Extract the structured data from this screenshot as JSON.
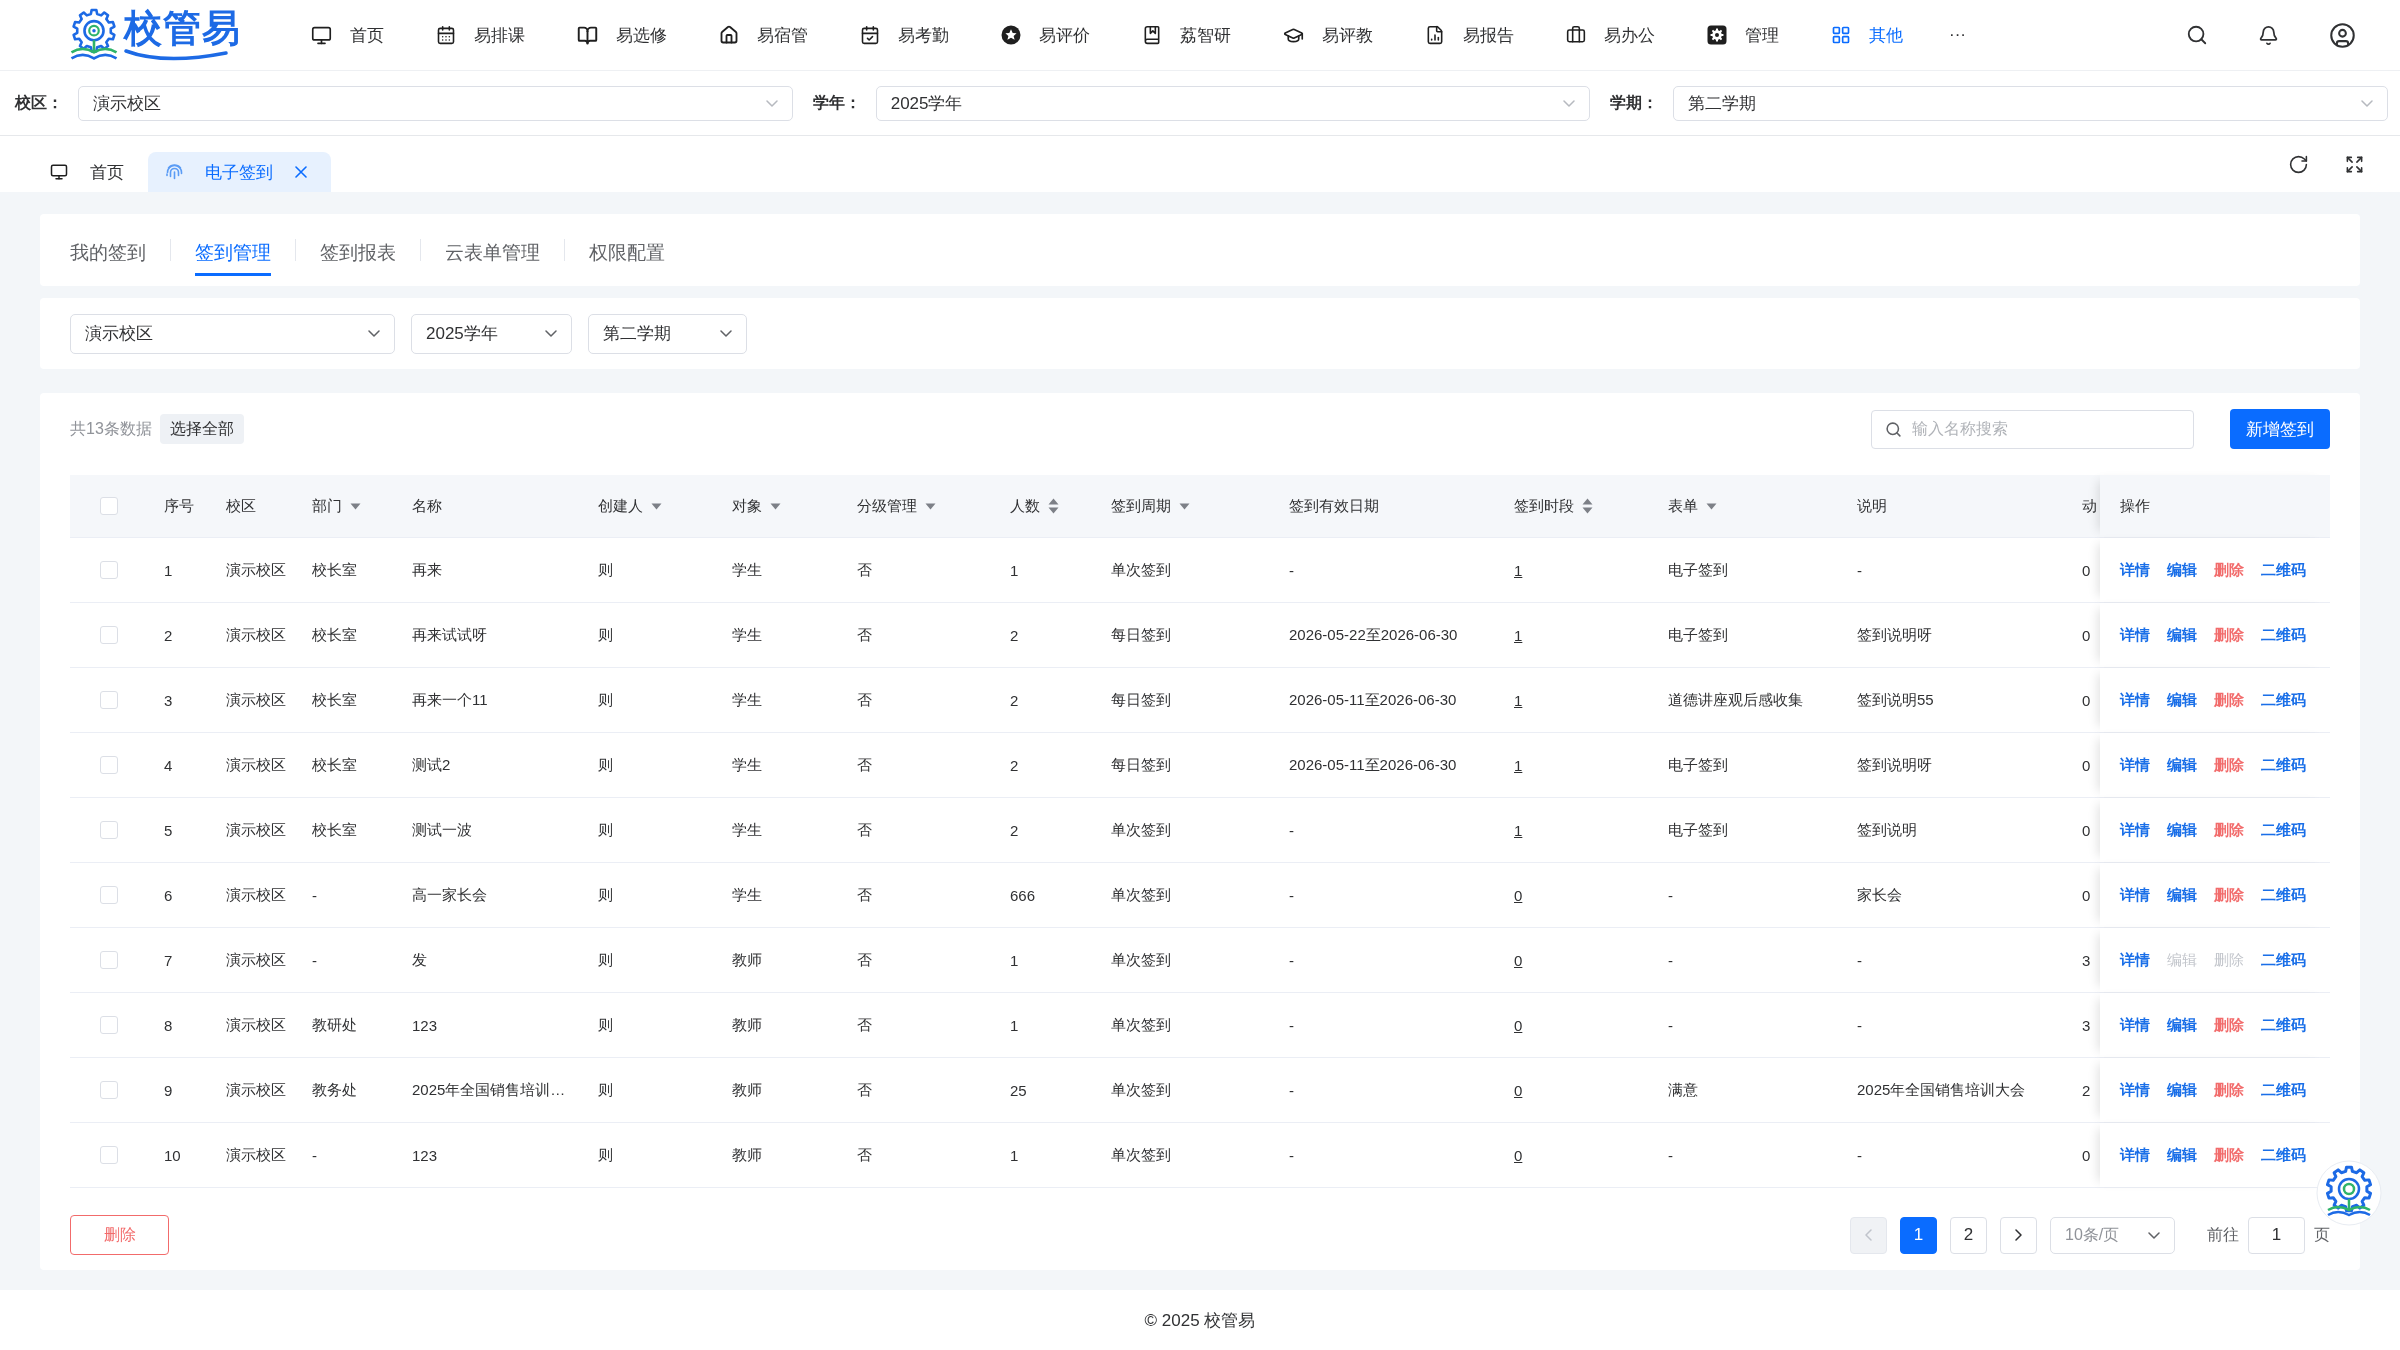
{
  "logo": {
    "text": "校管易"
  },
  "nav": {
    "items": [
      {
        "label": "首页",
        "selected": false
      },
      {
        "label": "易排课",
        "selected": false
      },
      {
        "label": "易选修",
        "selected": false
      },
      {
        "label": "易宿管",
        "selected": false
      },
      {
        "label": "易考勤",
        "selected": false
      },
      {
        "label": "易评价",
        "selected": false
      },
      {
        "label": "荔智研",
        "selected": false
      },
      {
        "label": "易评教",
        "selected": false
      },
      {
        "label": "易报告",
        "selected": false
      },
      {
        "label": "易办公",
        "selected": false
      },
      {
        "label": "管理",
        "selected": false
      },
      {
        "label": "其他",
        "selected": true
      }
    ],
    "more": "···"
  },
  "context_filters": [
    {
      "label": "校区：",
      "value": "演示校区"
    },
    {
      "label": "学年：",
      "value": "2025学年"
    },
    {
      "label": "学期：",
      "value": "第二学期"
    }
  ],
  "page_tabs": [
    {
      "label": "首页",
      "selected": false,
      "closable": false
    },
    {
      "label": "电子签到",
      "selected": true,
      "closable": true
    }
  ],
  "sub_tabs": [
    {
      "label": "我的签到",
      "selected": false
    },
    {
      "label": "签到管理",
      "selected": true
    },
    {
      "label": "签到报表",
      "selected": false
    },
    {
      "label": "云表单管理",
      "selected": false
    },
    {
      "label": "权限配置",
      "selected": false
    }
  ],
  "filters": [
    {
      "value": "演示校区"
    },
    {
      "value": "2025学年"
    },
    {
      "value": "第二学期"
    }
  ],
  "toolbar": {
    "total": "共13条数据",
    "select_all": "选择全部",
    "search": {
      "placeholder": "输入名称搜索"
    },
    "add_button": "新增签到"
  },
  "table": {
    "select_all_checked": false,
    "columns": [
      {
        "label": "序号",
        "kind": "plain",
        "link": false
      },
      {
        "label": "校区",
        "kind": "plain",
        "link": false
      },
      {
        "label": "部门",
        "kind": "filter",
        "link": false
      },
      {
        "label": "名称",
        "kind": "plain",
        "link": false
      },
      {
        "label": "创建人",
        "kind": "filter",
        "link": false
      },
      {
        "label": "对象",
        "kind": "filter",
        "link": false
      },
      {
        "label": "分级管理",
        "kind": "filter",
        "link": false
      },
      {
        "label": "人数",
        "kind": "sort",
        "link": false
      },
      {
        "label": "签到周期",
        "kind": "filter",
        "link": false
      },
      {
        "label": "签到有效日期",
        "kind": "plain",
        "link": false
      },
      {
        "label": "签到时段",
        "kind": "sort",
        "link": true
      },
      {
        "label": "表单",
        "kind": "filter",
        "link": false
      },
      {
        "label": "说明",
        "kind": "plain",
        "link": false
      },
      {
        "label": "动",
        "kind": "plain",
        "link": false
      }
    ],
    "actions_header": "操作",
    "rows": [
      {
        "checked": false,
        "cells": [
          "1",
          "演示校区",
          "校长室",
          "再来",
          "则",
          "学生",
          "否",
          "1",
          "单次签到",
          "-",
          "1",
          "电子签到",
          "-",
          "0"
        ],
        "actions": [
          {
            "label": "详情",
            "kind": "link",
            "disabled": false
          },
          {
            "label": "编辑",
            "kind": "link",
            "disabled": false
          },
          {
            "label": "删除",
            "kind": "danger",
            "disabled": false
          },
          {
            "label": "二维码",
            "kind": "link",
            "disabled": false
          }
        ]
      },
      {
        "checked": false,
        "cells": [
          "2",
          "演示校区",
          "校长室",
          "再来试试呀",
          "则",
          "学生",
          "否",
          "2",
          "每日签到",
          "2026-05-22至2026-06-30",
          "1",
          "电子签到",
          "签到说明呀",
          "0"
        ],
        "actions": [
          {
            "label": "详情",
            "kind": "link",
            "disabled": false
          },
          {
            "label": "编辑",
            "kind": "link",
            "disabled": false
          },
          {
            "label": "删除",
            "kind": "danger",
            "disabled": false
          },
          {
            "label": "二维码",
            "kind": "link",
            "disabled": false
          }
        ]
      },
      {
        "checked": false,
        "cells": [
          "3",
          "演示校区",
          "校长室",
          "再来一个11",
          "则",
          "学生",
          "否",
          "2",
          "每日签到",
          "2026-05-11至2026-06-30",
          "1",
          "道德讲座观后感收集",
          "签到说明55",
          "0"
        ],
        "actions": [
          {
            "label": "详情",
            "kind": "link",
            "disabled": false
          },
          {
            "label": "编辑",
            "kind": "link",
            "disabled": false
          },
          {
            "label": "删除",
            "kind": "danger",
            "disabled": false
          },
          {
            "label": "二维码",
            "kind": "link",
            "disabled": false
          }
        ]
      },
      {
        "checked": false,
        "cells": [
          "4",
          "演示校区",
          "校长室",
          "测试2",
          "则",
          "学生",
          "否",
          "2",
          "每日签到",
          "2026-05-11至2026-06-30",
          "1",
          "电子签到",
          "签到说明呀",
          "0"
        ],
        "actions": [
          {
            "label": "详情",
            "kind": "link",
            "disabled": false
          },
          {
            "label": "编辑",
            "kind": "link",
            "disabled": false
          },
          {
            "label": "删除",
            "kind": "danger",
            "disabled": false
          },
          {
            "label": "二维码",
            "kind": "link",
            "disabled": false
          }
        ]
      },
      {
        "checked": false,
        "cells": [
          "5",
          "演示校区",
          "校长室",
          "测试一波",
          "则",
          "学生",
          "否",
          "2",
          "单次签到",
          "-",
          "1",
          "电子签到",
          "签到说明",
          "0"
        ],
        "actions": [
          {
            "label": "详情",
            "kind": "link",
            "disabled": false
          },
          {
            "label": "编辑",
            "kind": "link",
            "disabled": false
          },
          {
            "label": "删除",
            "kind": "danger",
            "disabled": false
          },
          {
            "label": "二维码",
            "kind": "link",
            "disabled": false
          }
        ]
      },
      {
        "checked": false,
        "cells": [
          "6",
          "演示校区",
          "-",
          "高一家长会",
          "则",
          "学生",
          "否",
          "666",
          "单次签到",
          "-",
          "0",
          "-",
          "家长会",
          "0"
        ],
        "actions": [
          {
            "label": "详情",
            "kind": "link",
            "disabled": false
          },
          {
            "label": "编辑",
            "kind": "link",
            "disabled": false
          },
          {
            "label": "删除",
            "kind": "danger",
            "disabled": false
          },
          {
            "label": "二维码",
            "kind": "link",
            "disabled": false
          }
        ]
      },
      {
        "checked": false,
        "cells": [
          "7",
          "演示校区",
          "-",
          "发",
          "则",
          "教师",
          "否",
          "1",
          "单次签到",
          "-",
          "0",
          "-",
          "-",
          "3"
        ],
        "actions": [
          {
            "label": "详情",
            "kind": "link",
            "disabled": false
          },
          {
            "label": "编辑",
            "kind": "link",
            "disabled": true
          },
          {
            "label": "删除",
            "kind": "danger",
            "disabled": true
          },
          {
            "label": "二维码",
            "kind": "link",
            "disabled": false
          }
        ]
      },
      {
        "checked": false,
        "cells": [
          "8",
          "演示校区",
          "教研处",
          "123",
          "则",
          "教师",
          "否",
          "1",
          "单次签到",
          "-",
          "0",
          "-",
          "-",
          "3"
        ],
        "actions": [
          {
            "label": "详情",
            "kind": "link",
            "disabled": false
          },
          {
            "label": "编辑",
            "kind": "link",
            "disabled": false
          },
          {
            "label": "删除",
            "kind": "danger",
            "disabled": false
          },
          {
            "label": "二维码",
            "kind": "link",
            "disabled": false
          }
        ]
      },
      {
        "checked": false,
        "cells": [
          "9",
          "演示校区",
          "教务处",
          "2025年全国销售培训…",
          "则",
          "教师",
          "否",
          "25",
          "单次签到",
          "-",
          "0",
          "满意",
          "2025年全国销售培训大会",
          "2"
        ],
        "actions": [
          {
            "label": "详情",
            "kind": "link",
            "disabled": false
          },
          {
            "label": "编辑",
            "kind": "link",
            "disabled": false
          },
          {
            "label": "删除",
            "kind": "danger",
            "disabled": false
          },
          {
            "label": "二维码",
            "kind": "link",
            "disabled": false
          }
        ]
      },
      {
        "checked": false,
        "cells": [
          "10",
          "演示校区",
          "-",
          "123",
          "则",
          "教师",
          "否",
          "1",
          "单次签到",
          "-",
          "0",
          "-",
          "-",
          "0"
        ],
        "actions": [
          {
            "label": "详情",
            "kind": "link",
            "disabled": false
          },
          {
            "label": "编辑",
            "kind": "link",
            "disabled": false
          },
          {
            "label": "删除",
            "kind": "danger",
            "disabled": false
          },
          {
            "label": "二维码",
            "kind": "link",
            "disabled": false
          }
        ]
      }
    ]
  },
  "bulk_delete": "删除",
  "pagination": {
    "prev_disabled": true,
    "pages": [
      {
        "label": "1",
        "selected": true
      },
      {
        "label": "2",
        "selected": false
      }
    ],
    "page_size": "10条/页",
    "goto_label": "前往",
    "goto_value": "1",
    "goto_suffix": "页"
  },
  "footer": "© 2025 校管易"
}
